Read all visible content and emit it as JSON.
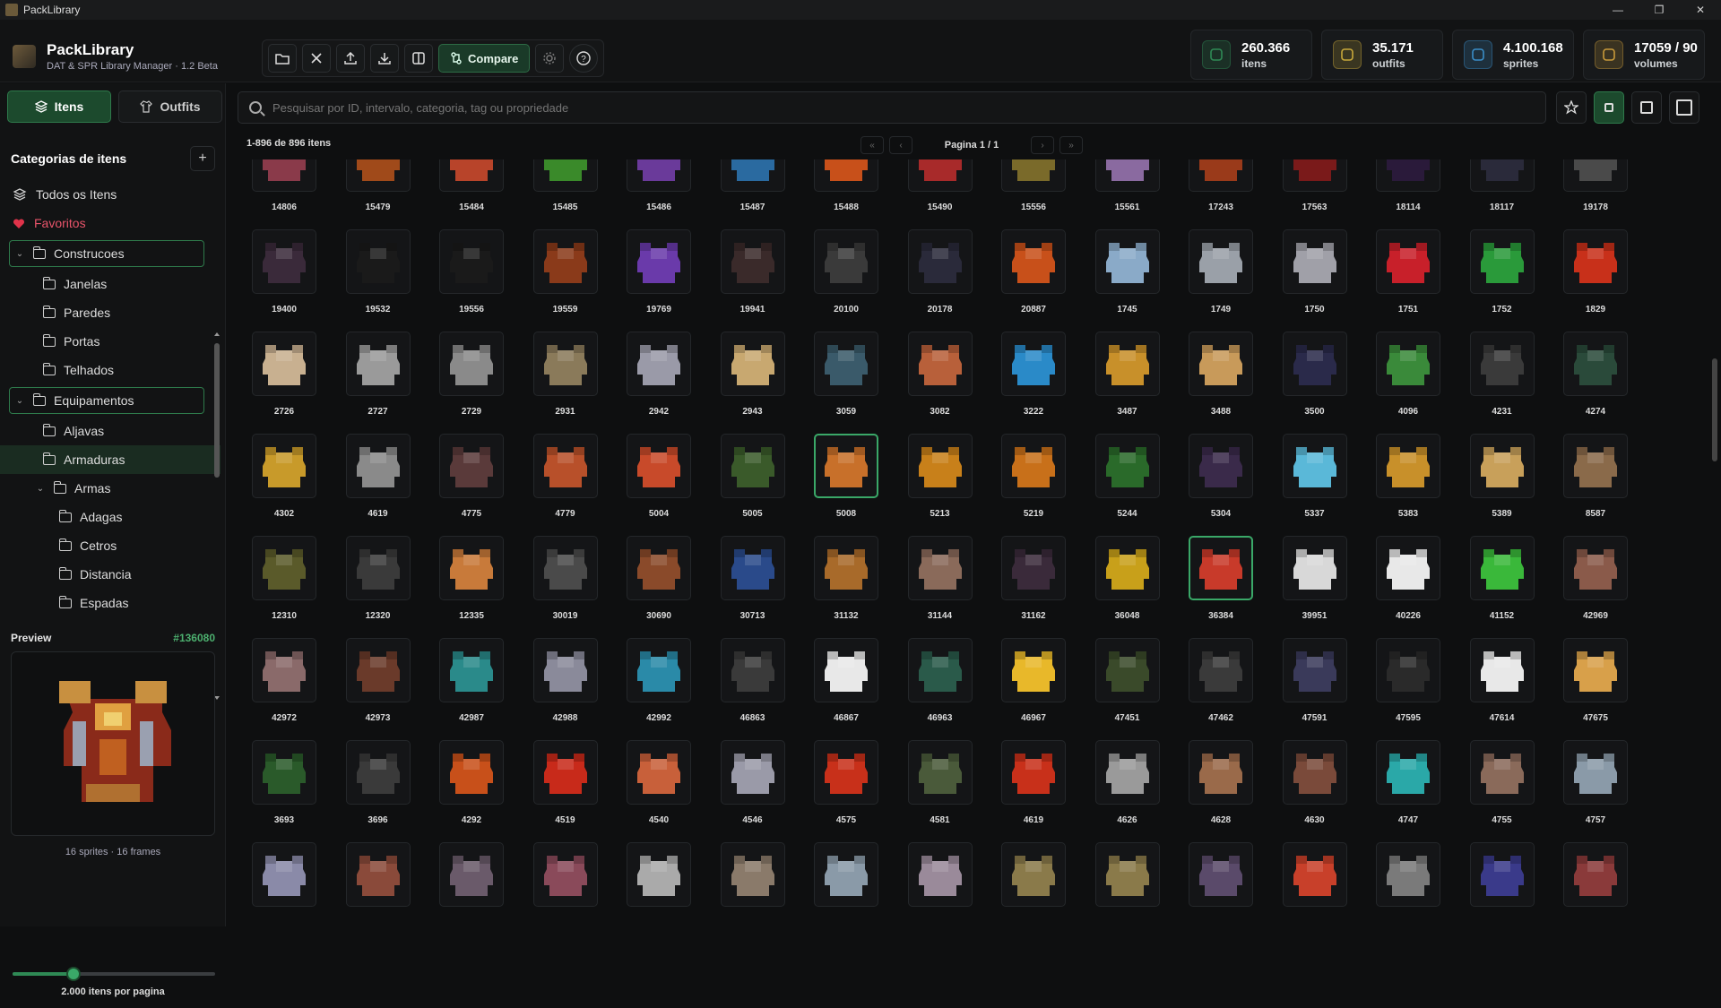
{
  "window": {
    "title": "PackLibrary",
    "controls": [
      "—",
      "❐",
      "✕"
    ]
  },
  "brand": {
    "name": "PackLibrary",
    "subtitle": "DAT & SPR Library Manager · 1.2 Beta"
  },
  "toolbar": {
    "compare_label": "Compare"
  },
  "stats": [
    {
      "value": "260.366",
      "label": "itens",
      "icon": "items-icon",
      "color": "#2f8a55"
    },
    {
      "value": "35.171",
      "label": "outfits",
      "icon": "shirt-icon",
      "color": "#c8a83a"
    },
    {
      "value": "4.100.168",
      "label": "sprites",
      "icon": "image-icon",
      "color": "#3a8ec8"
    },
    {
      "value": "17059 / 90",
      "label": "volumes",
      "icon": "stack-icon",
      "color": "#c89a3a"
    }
  ],
  "tabs": {
    "items_label": "Itens",
    "outfits_label": "Outfits"
  },
  "categories": {
    "title": "Categorias de itens",
    "add": "+"
  },
  "tree": [
    {
      "label": "Todos os Itens",
      "level": 0,
      "type": "all"
    },
    {
      "label": "Favoritos",
      "level": 0,
      "type": "fav"
    },
    {
      "label": "Construcoes",
      "level": 0,
      "type": "folder",
      "expanded": true,
      "boxed": true
    },
    {
      "label": "Janelas",
      "level": 1,
      "type": "folder"
    },
    {
      "label": "Paredes",
      "level": 1,
      "type": "folder"
    },
    {
      "label": "Portas",
      "level": 1,
      "type": "folder"
    },
    {
      "label": "Telhados",
      "level": 1,
      "type": "folder"
    },
    {
      "label": "Equipamentos",
      "level": 0,
      "type": "folder",
      "expanded": true,
      "boxed": true
    },
    {
      "label": "Aljavas",
      "level": 1,
      "type": "folder"
    },
    {
      "label": "Armaduras",
      "level": 1,
      "type": "folder",
      "selected": true
    },
    {
      "label": "Armas",
      "level": 1,
      "type": "folder",
      "expanded": true
    },
    {
      "label": "Adagas",
      "level": 2,
      "type": "folder"
    },
    {
      "label": "Cetros",
      "level": 2,
      "type": "folder"
    },
    {
      "label": "Distancia",
      "level": 2,
      "type": "folder"
    },
    {
      "label": "Espadas",
      "level": 2,
      "type": "folder"
    }
  ],
  "preview": {
    "title": "Preview",
    "id": "#136080",
    "info": "16 sprites · 16 frames"
  },
  "per_page": {
    "label": "2.000 itens por pagina",
    "fraction": 0.3
  },
  "search": {
    "placeholder": "Pesquisar por ID, intervalo, categoria, tag ou propriedade"
  },
  "results": {
    "count": "1-896 de 896 itens",
    "page": "Pagina 1 / 1",
    "first": "«",
    "prev": "‹",
    "next": "›",
    "last": "»"
  },
  "items": [
    "14806",
    "15479",
    "15484",
    "15485",
    "15486",
    "15487",
    "15488",
    "15490",
    "15556",
    "15561",
    "17243",
    "17563",
    "18114",
    "18117",
    "19178",
    "19400",
    "19532",
    "19556",
    "19559",
    "19769",
    "19941",
    "20100",
    "20178",
    "20887",
    "1745",
    "1749",
    "1750",
    "1751",
    "1752",
    "1829",
    "2726",
    "2727",
    "2729",
    "2931",
    "2942",
    "2943",
    "3059",
    "3082",
    "3222",
    "3487",
    "3488",
    "3500",
    "4096",
    "4231",
    "4274",
    "4302",
    "4619",
    "4775",
    "4779",
    "5004",
    "5005",
    "5008",
    "5213",
    "5219",
    "5244",
    "5304",
    "5337",
    "5383",
    "5389",
    "8587",
    "12310",
    "12320",
    "12335",
    "30019",
    "30690",
    "30713",
    "31132",
    "31144",
    "31162",
    "36048",
    "36384",
    "39951",
    "40226",
    "41152",
    "42969",
    "42972",
    "42973",
    "42987",
    "42988",
    "42992",
    "46863",
    "46867",
    "46963",
    "46967",
    "47451",
    "47462",
    "47591",
    "47595",
    "47614",
    "47675",
    "3693",
    "3696",
    "4292",
    "4519",
    "4540",
    "4546",
    "4575",
    "4581",
    "4619",
    "4626",
    "4628",
    "4630",
    "4747",
    "4755",
    "4757",
    "",
    "",
    "",
    "",
    "",
    "",
    "",
    "",
    "",
    "",
    "",
    "",
    "",
    "",
    ""
  ],
  "item_colors": [
    "#8a3a4a",
    "#a04a1a",
    "#b8442a",
    "#3a8a2a",
    "#6a3a9a",
    "#2a6aa0",
    "#c8501a",
    "#a82a2a",
    "#7a6a2a",
    "#8a6aa0",
    "#9a3a1a",
    "#7a1a1a",
    "#2a1a3a",
    "#2a2a3a",
    "#4a4a4a",
    "#3a2a3a",
    "#1a1a1a",
    "#1a1a1a",
    "#8a3a1a",
    "#6a3aaa",
    "#3a2a2a",
    "#3a3a3a",
    "#2a2a3a",
    "#c8501a",
    "#8aaac8",
    "#9aa0a8",
    "#a0a0a8",
    "#c8202a",
    "#2a9a3a",
    "#c8301a",
    "#c8b090",
    "#9a9a9a",
    "#8a8a8a",
    "#8a7a5a",
    "#9a9aa8",
    "#c8a870",
    "#3a5a6a",
    "#b8603a",
    "#2a8ac8",
    "#c8902a",
    "#c89a5a",
    "#2a2a4a",
    "#3a8a3a",
    "#3a3a3a",
    "#2a4a3a",
    "#c89a2a",
    "#8a8a8a",
    "#5a3a3a",
    "#b8502a",
    "#c84a2a",
    "#3a5a2a",
    "#c8702a",
    "#c8801a",
    "#c8701a",
    "#2a6a2a",
    "#3a2a4a",
    "#5ab8d8",
    "#c8902a",
    "#c8a05a",
    "#8a6a4a",
    "#5a5a2a",
    "#3a3a3a",
    "#c87a3a",
    "#4a4a4a",
    "#8a4a2a",
    "#2a4a8a",
    "#a86a2a",
    "#8a6a5a",
    "#3a2a3a",
    "#c8a01a",
    "#c83a2a",
    "#d8d8d8",
    "#e8e8e8",
    "#3ab83a",
    "#8a5a4a",
    "#8a6a6a",
    "#6a3a2a",
    "#2a8a8a",
    "#8a8a9a",
    "#2a8aa8",
    "#3a3a3a",
    "#e8e8e8",
    "#2a5a4a",
    "#e8b82a",
    "#3a4a2a",
    "#3a3a3a",
    "#3a3a5a",
    "#2a2a2a",
    "#e8e8e8",
    "#d8a04a",
    "#2a5a2a",
    "#3a3a3a",
    "#c8501a",
    "#c82a1a",
    "#c8603a",
    "#9a9aa8",
    "#c8301a",
    "#4a5a3a",
    "#c8301a",
    "#9a9a9a",
    "#9a6a4a",
    "#7a4a3a",
    "#2aa8a8",
    "#8a6a5a",
    "#8a9aa8",
    "#8a8aa8",
    "#8a4a3a",
    "#6a5a6a",
    "#8a4a5a",
    "#aaaaaa",
    "#8a7a6a",
    "#8a9aa8",
    "#9a8a9a",
    "#8a7a4a",
    "#8a7a4a",
    "#5a4a6a",
    "#c8402a",
    "#7a7a7a",
    "#3a3a8a",
    "#8a3a3a"
  ],
  "selected_indices": [
    51,
    70
  ]
}
